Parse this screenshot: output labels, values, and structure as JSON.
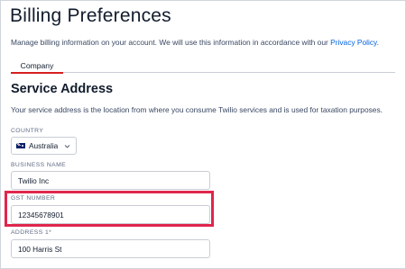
{
  "page": {
    "title": "Billing Preferences",
    "intro_text": "Manage billing information on your account. We will use this information in accordance with our ",
    "privacy_link": "Privacy Policy",
    "intro_end": "."
  },
  "tabs": [
    {
      "label": "Company",
      "active": true
    }
  ],
  "service_address": {
    "title": "Service Address",
    "description": "Your service address is the location from where you consume Twilio services and is used for taxation purposes."
  },
  "fields": {
    "country": {
      "label": "COUNTRY",
      "value": "Australia",
      "flag_icon": "australia-flag-icon"
    },
    "business_name": {
      "label": "BUSINESS NAME",
      "value": "Twilio Inc"
    },
    "gst_number": {
      "label": "GST NUMBER",
      "value": "12345678901"
    },
    "address1": {
      "label": "ADDRESS 1*",
      "value": "100 Harris St"
    }
  },
  "colors": {
    "link": "#0263e0",
    "tab_underline": "#d61f1f",
    "highlight": "#e0264d"
  }
}
